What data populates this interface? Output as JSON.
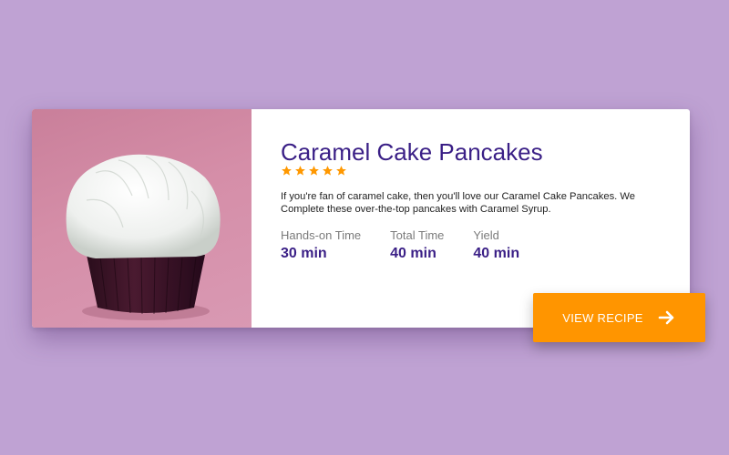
{
  "recipe": {
    "title": "Caramel Cake Pancakes",
    "rating": 5,
    "description": "If you're fan of caramel cake, then you'll love our Caramel Cake Pancakes. We Complete these over-the-top pancakes with Caramel Syrup.",
    "stats": [
      {
        "label": "Hands-on Time",
        "value": "30 min"
      },
      {
        "label": "Total Time",
        "value": "40 min"
      },
      {
        "label": "Yield",
        "value": "40 min"
      }
    ]
  },
  "button": {
    "label": "VIEW RECIPE",
    "icon": "arrow-right-icon"
  },
  "colors": {
    "background": "#bfa2d3",
    "title": "#3a1f86",
    "star": "#ff9800",
    "button": "#ff9500"
  },
  "image": {
    "subject": "cupcake-photo"
  }
}
